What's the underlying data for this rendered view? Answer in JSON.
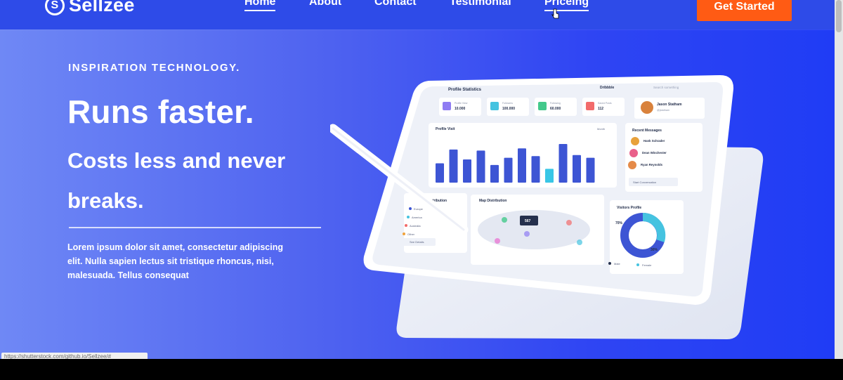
{
  "brand": {
    "name": "Sellzee",
    "logo_letter": "S"
  },
  "nav": {
    "items": [
      {
        "label": "Home"
      },
      {
        "label": "About"
      },
      {
        "label": "Contact"
      },
      {
        "label": "Testimonial"
      },
      {
        "label": "Priceing"
      }
    ],
    "active": "Home",
    "hovered": "Priceing"
  },
  "cta": {
    "label": "Get Started"
  },
  "hero": {
    "eyebrow": "INSPIRATION TECHNOLOGY.",
    "title": "Runs faster.",
    "subtitle": "Costs less and never breaks.",
    "body": "Lorem ipsum dolor sit amet, consectetur adipiscing elit. Nulla sapien lectus sit tristique rhoncus, nisi, malesuada. Tellus consequat"
  },
  "dashboard": {
    "title": "Profile Statistics",
    "dropdown": "Dribbble",
    "search_placeholder": "Search something",
    "stats": [
      {
        "label": "Profile View",
        "value": "10.000"
      },
      {
        "label": "Followers",
        "value": "100.000"
      },
      {
        "label": "Following",
        "value": "60.000"
      },
      {
        "label": "Saved Posts",
        "value": "112"
      }
    ],
    "user": {
      "name": "Jason Statham",
      "handle": "@jstatham"
    },
    "profile_visit": {
      "title": "Profile Visit",
      "period": "Month",
      "values": [
        35,
        60,
        42,
        58,
        32,
        45,
        62,
        48,
        25,
        70,
        50,
        45
      ]
    },
    "recent_messages": {
      "title": "Recent Messages",
      "people": [
        {
          "name": "Hank Schrader"
        },
        {
          "name": "Dean Winchester"
        },
        {
          "name": "Ryan Reynolds"
        }
      ],
      "button": "Start Conversation"
    },
    "distribution": {
      "title": "Distribution",
      "rows": [
        "Europe",
        "America",
        "Australia",
        "Other"
      ],
      "button": "See Details"
    },
    "map": {
      "title": "Map Distribution",
      "tooltip": "567"
    },
    "visitors": {
      "title": "Visitors Profile",
      "male_pct": "70%",
      "female_pct": "30%",
      "legend": [
        "Male",
        "Female"
      ]
    }
  },
  "status_bar": {
    "url": "https://shutterstock.com/github.io/Sellzee/#"
  },
  "colors": {
    "accent": "#ff5b14",
    "bar": "#3d55d4",
    "bar_highlight": "#38c6e6"
  }
}
